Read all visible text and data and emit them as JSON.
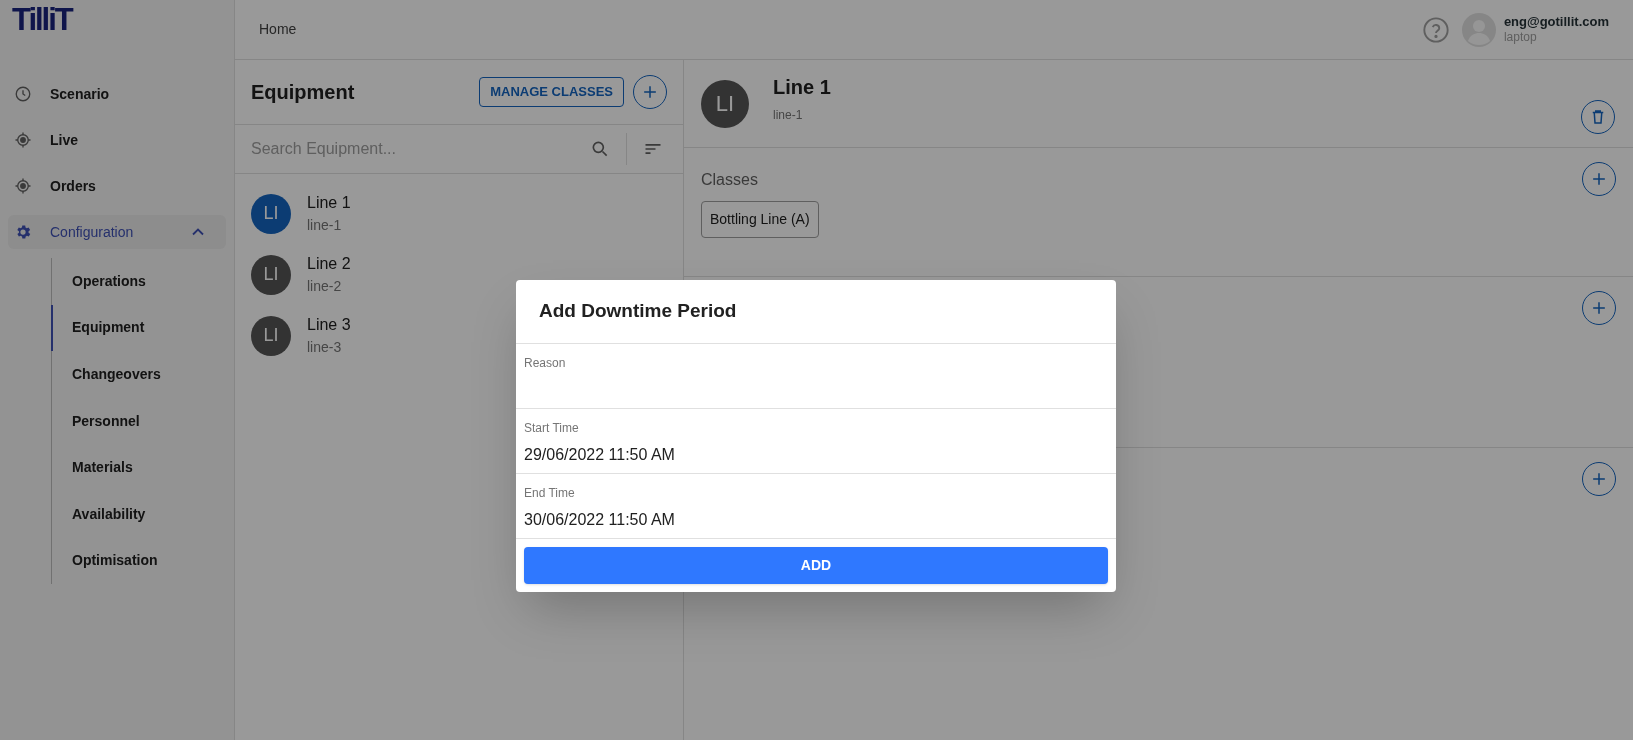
{
  "logo": "TilliT",
  "header": {
    "breadcrumb": "Home",
    "user": {
      "email": "eng@gotillit.com",
      "device": "laptop"
    }
  },
  "sidebar": {
    "items": [
      {
        "label": "Scenario",
        "kind": "clock",
        "selected": false
      },
      {
        "label": "Live",
        "kind": "target",
        "selected": false
      },
      {
        "label": "Orders",
        "kind": "target",
        "selected": false
      },
      {
        "label": "Configuration",
        "kind": "gear",
        "selected": true,
        "expanded": true,
        "children": [
          {
            "label": "Operations",
            "selected": false
          },
          {
            "label": "Equipment",
            "selected": true
          },
          {
            "label": "Changeovers",
            "selected": false
          },
          {
            "label": "Personnel",
            "selected": false
          },
          {
            "label": "Materials",
            "selected": false
          },
          {
            "label": "Availability",
            "selected": false
          },
          {
            "label": "Optimisation",
            "selected": false
          }
        ]
      }
    ]
  },
  "equipment": {
    "title": "Equipment",
    "manage_button": "MANAGE CLASSES",
    "search": {
      "placeholder": "Search Equipment..."
    },
    "items": [
      {
        "initials": "LI",
        "name": "Line 1",
        "id": "line-1",
        "selected": true
      },
      {
        "initials": "LI",
        "name": "Line 2",
        "id": "line-2",
        "selected": false
      },
      {
        "initials": "LI",
        "name": "Line 3",
        "id": "line-3",
        "selected": false
      }
    ]
  },
  "detail": {
    "initials": "LI",
    "name": "Line 1",
    "id": "line-1",
    "classes": {
      "title": "Classes",
      "chips": [
        "Bottling Line (A)"
      ]
    }
  },
  "dialog": {
    "title": "Add Downtime Period",
    "fields": [
      {
        "label": "Reason"
      },
      {
        "label": "Start Time",
        "value": "29/06/2022 11:50 AM"
      },
      {
        "label": "End Time",
        "value": "30/06/2022 11:50 AM"
      }
    ],
    "button": "ADD"
  }
}
